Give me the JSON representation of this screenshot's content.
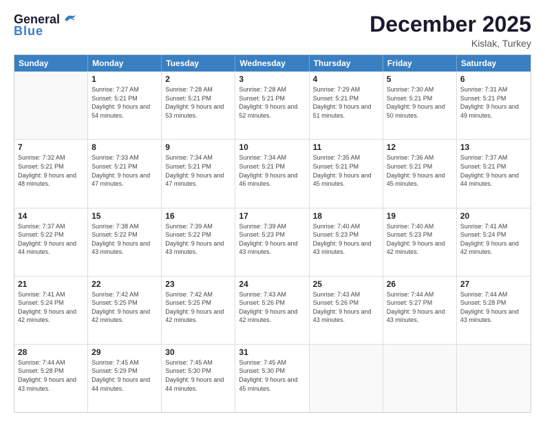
{
  "header": {
    "logo_line1": "General",
    "logo_line2": "Blue",
    "month": "December 2025",
    "location": "Kislak, Turkey"
  },
  "weekdays": [
    "Sunday",
    "Monday",
    "Tuesday",
    "Wednesday",
    "Thursday",
    "Friday",
    "Saturday"
  ],
  "rows": [
    [
      {
        "day": "",
        "sunrise": "",
        "sunset": "",
        "daylight": ""
      },
      {
        "day": "1",
        "sunrise": "Sunrise: 7:27 AM",
        "sunset": "Sunset: 5:21 PM",
        "daylight": "Daylight: 9 hours and 54 minutes."
      },
      {
        "day": "2",
        "sunrise": "Sunrise: 7:28 AM",
        "sunset": "Sunset: 5:21 PM",
        "daylight": "Daylight: 9 hours and 53 minutes."
      },
      {
        "day": "3",
        "sunrise": "Sunrise: 7:28 AM",
        "sunset": "Sunset: 5:21 PM",
        "daylight": "Daylight: 9 hours and 52 minutes."
      },
      {
        "day": "4",
        "sunrise": "Sunrise: 7:29 AM",
        "sunset": "Sunset: 5:21 PM",
        "daylight": "Daylight: 9 hours and 51 minutes."
      },
      {
        "day": "5",
        "sunrise": "Sunrise: 7:30 AM",
        "sunset": "Sunset: 5:21 PM",
        "daylight": "Daylight: 9 hours and 50 minutes."
      },
      {
        "day": "6",
        "sunrise": "Sunrise: 7:31 AM",
        "sunset": "Sunset: 5:21 PM",
        "daylight": "Daylight: 9 hours and 49 minutes."
      }
    ],
    [
      {
        "day": "7",
        "sunrise": "Sunrise: 7:32 AM",
        "sunset": "Sunset: 5:21 PM",
        "daylight": "Daylight: 9 hours and 48 minutes."
      },
      {
        "day": "8",
        "sunrise": "Sunrise: 7:33 AM",
        "sunset": "Sunset: 5:21 PM",
        "daylight": "Daylight: 9 hours and 47 minutes."
      },
      {
        "day": "9",
        "sunrise": "Sunrise: 7:34 AM",
        "sunset": "Sunset: 5:21 PM",
        "daylight": "Daylight: 9 hours and 47 minutes."
      },
      {
        "day": "10",
        "sunrise": "Sunrise: 7:34 AM",
        "sunset": "Sunset: 5:21 PM",
        "daylight": "Daylight: 9 hours and 46 minutes."
      },
      {
        "day": "11",
        "sunrise": "Sunrise: 7:35 AM",
        "sunset": "Sunset: 5:21 PM",
        "daylight": "Daylight: 9 hours and 45 minutes."
      },
      {
        "day": "12",
        "sunrise": "Sunrise: 7:36 AM",
        "sunset": "Sunset: 5:21 PM",
        "daylight": "Daylight: 9 hours and 45 minutes."
      },
      {
        "day": "13",
        "sunrise": "Sunrise: 7:37 AM",
        "sunset": "Sunset: 5:21 PM",
        "daylight": "Daylight: 9 hours and 44 minutes."
      }
    ],
    [
      {
        "day": "14",
        "sunrise": "Sunrise: 7:37 AM",
        "sunset": "Sunset: 5:22 PM",
        "daylight": "Daylight: 9 hours and 44 minutes."
      },
      {
        "day": "15",
        "sunrise": "Sunrise: 7:38 AM",
        "sunset": "Sunset: 5:22 PM",
        "daylight": "Daylight: 9 hours and 43 minutes."
      },
      {
        "day": "16",
        "sunrise": "Sunrise: 7:39 AM",
        "sunset": "Sunset: 5:22 PM",
        "daylight": "Daylight: 9 hours and 43 minutes."
      },
      {
        "day": "17",
        "sunrise": "Sunrise: 7:39 AM",
        "sunset": "Sunset: 5:23 PM",
        "daylight": "Daylight: 9 hours and 43 minutes."
      },
      {
        "day": "18",
        "sunrise": "Sunrise: 7:40 AM",
        "sunset": "Sunset: 5:23 PM",
        "daylight": "Daylight: 9 hours and 43 minutes."
      },
      {
        "day": "19",
        "sunrise": "Sunrise: 7:40 AM",
        "sunset": "Sunset: 5:23 PM",
        "daylight": "Daylight: 9 hours and 42 minutes."
      },
      {
        "day": "20",
        "sunrise": "Sunrise: 7:41 AM",
        "sunset": "Sunset: 5:24 PM",
        "daylight": "Daylight: 9 hours and 42 minutes."
      }
    ],
    [
      {
        "day": "21",
        "sunrise": "Sunrise: 7:41 AM",
        "sunset": "Sunset: 5:24 PM",
        "daylight": "Daylight: 9 hours and 42 minutes."
      },
      {
        "day": "22",
        "sunrise": "Sunrise: 7:42 AM",
        "sunset": "Sunset: 5:25 PM",
        "daylight": "Daylight: 9 hours and 42 minutes."
      },
      {
        "day": "23",
        "sunrise": "Sunrise: 7:42 AM",
        "sunset": "Sunset: 5:25 PM",
        "daylight": "Daylight: 9 hours and 42 minutes."
      },
      {
        "day": "24",
        "sunrise": "Sunrise: 7:43 AM",
        "sunset": "Sunset: 5:26 PM",
        "daylight": "Daylight: 9 hours and 42 minutes."
      },
      {
        "day": "25",
        "sunrise": "Sunrise: 7:43 AM",
        "sunset": "Sunset: 5:26 PM",
        "daylight": "Daylight: 9 hours and 43 minutes."
      },
      {
        "day": "26",
        "sunrise": "Sunrise: 7:44 AM",
        "sunset": "Sunset: 5:27 PM",
        "daylight": "Daylight: 9 hours and 43 minutes."
      },
      {
        "day": "27",
        "sunrise": "Sunrise: 7:44 AM",
        "sunset": "Sunset: 5:28 PM",
        "daylight": "Daylight: 9 hours and 43 minutes."
      }
    ],
    [
      {
        "day": "28",
        "sunrise": "Sunrise: 7:44 AM",
        "sunset": "Sunset: 5:28 PM",
        "daylight": "Daylight: 9 hours and 43 minutes."
      },
      {
        "day": "29",
        "sunrise": "Sunrise: 7:45 AM",
        "sunset": "Sunset: 5:29 PM",
        "daylight": "Daylight: 9 hours and 44 minutes."
      },
      {
        "day": "30",
        "sunrise": "Sunrise: 7:45 AM",
        "sunset": "Sunset: 5:30 PM",
        "daylight": "Daylight: 9 hours and 44 minutes."
      },
      {
        "day": "31",
        "sunrise": "Sunrise: 7:45 AM",
        "sunset": "Sunset: 5:30 PM",
        "daylight": "Daylight: 9 hours and 45 minutes."
      },
      {
        "day": "",
        "sunrise": "",
        "sunset": "",
        "daylight": ""
      },
      {
        "day": "",
        "sunrise": "",
        "sunset": "",
        "daylight": ""
      },
      {
        "day": "",
        "sunrise": "",
        "sunset": "",
        "daylight": ""
      }
    ]
  ]
}
